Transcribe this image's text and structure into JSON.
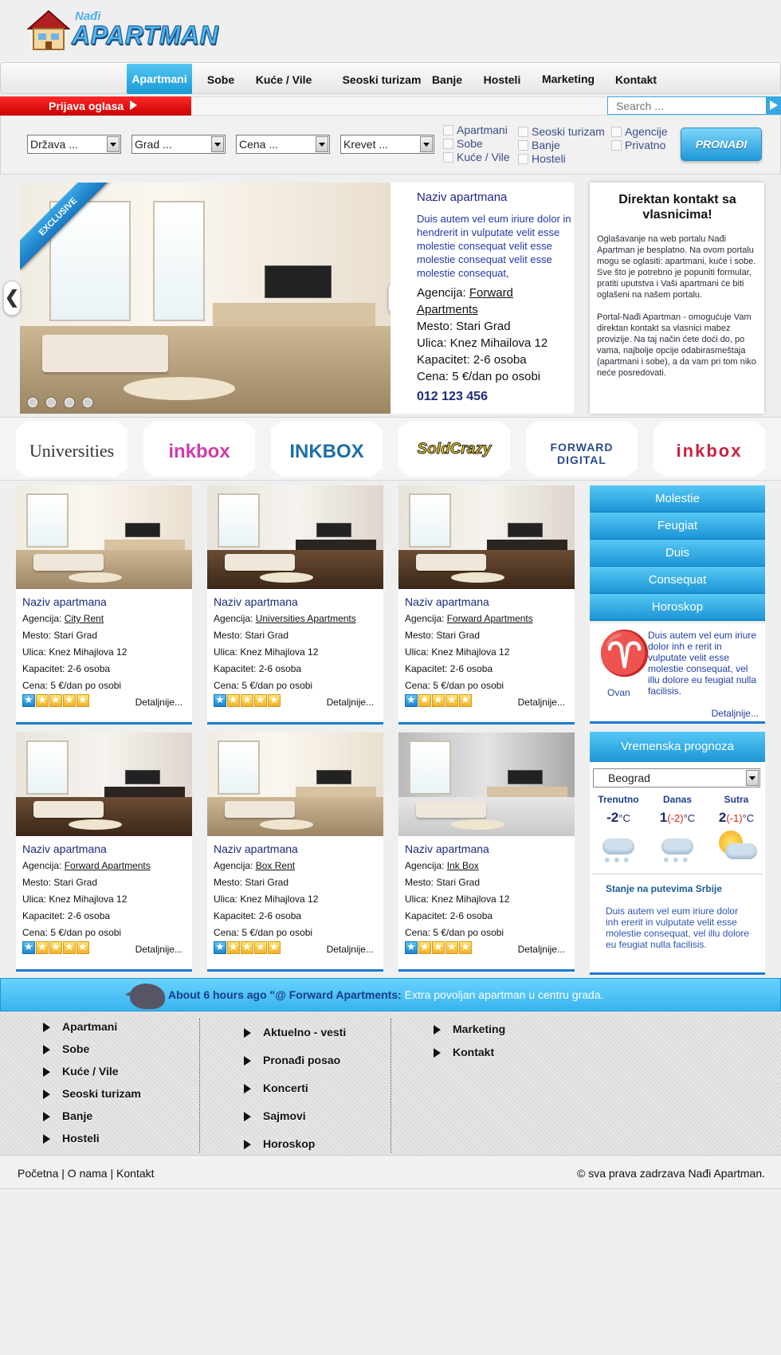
{
  "logo": {
    "top": "Nađi",
    "main": "APARTMAN"
  },
  "nav": [
    "Apartmani",
    "Sobe",
    "Kuće / Vile",
    "Seoski turizam",
    "Banje",
    "Hosteli",
    "Marketing",
    "Kontakt"
  ],
  "nav_active": "Apartmani",
  "prijava": "Prijava oglasa",
  "search": {
    "placeholder": "Search ..."
  },
  "filters": {
    "selects": [
      "Država ...",
      "Grad ...",
      "Cena ...",
      "Krevet ..."
    ],
    "checkboxes": [
      "Apartmani",
      "Sobe",
      "Kuće / Vile",
      "Seoski turizam",
      "Banje",
      "Hosteli",
      "Agencije",
      "Privatno"
    ],
    "button": "PRONAĐI"
  },
  "featured": {
    "badge": "EXCLUSIVE",
    "title": "Naziv apartmana",
    "description": "Duis autem vel eum iriure dolor in hendrerit in vulputate velit esse molestie consequat velit esse molestie consequat velit esse molestie consequat,",
    "agencija_label": "Agencija:",
    "agencija": "Forward Apartments",
    "mesto": "Mesto: Stari Grad",
    "ulica": "Ulica: Knez Mihailova 12",
    "kapacitet": "Kapacitet: 2-6 osoba",
    "cena": "Cena: 5 €/dan po osobi",
    "phone": "012 123 456",
    "prev": "❮",
    "next": "❯"
  },
  "contact": {
    "title": "Direktan kontakt sa vlasnicima!",
    "p1": "Oglašavanje na web portalu Nađi Apartman je besplatno. Na ovom portalu mogu se oglasiti: apartmani, kuće i sobe. Sve što je potrebno je popuniti formular, pratiti uputstva i Vaši apartmani će biti oglašeni na našem portalu.",
    "p2": "Portal-Nađi Apartman - omogućuje Vam direktan kontakt sa vlasnici mabez provizije. Na taj način ćete doći do, po vama, najbolje opcije odabirasmeštaja (apartmani i sobe), a da vam pri tom niko neće posredovati."
  },
  "partners": [
    "Universities",
    "inkbox",
    "INKBOX",
    "SoldCrazy",
    "FORWARD DIGITAL",
    "inkbox"
  ],
  "cards": [
    {
      "title": "Naziv apartmana",
      "agencija_label": "Agencija:",
      "agencija": "City Rent",
      "mesto": "Mesto: Stari Grad",
      "ulica": "Ulica: Knez Mihajlova 12",
      "kapacitet": "Kapacitet: 2-6 osoba",
      "cena": "Cena: 5 €/dan po osobi",
      "more": "Detaljnije..."
    },
    {
      "title": "Naziv apartmana",
      "agencija_label": "Agencija:",
      "agencija": "Universities Apartments",
      "mesto": "Mesto: Stari Grad",
      "ulica": "Ulica: Knez Mihajlova 12",
      "kapacitet": "Kapacitet: 2-6 osoba",
      "cena": "Cena: 5 €/dan po osobi",
      "more": "Detaljnije..."
    },
    {
      "title": "Naziv apartmana",
      "agencija_label": "Agencija:",
      "agencija": "Forward Apartments",
      "mesto": "Mesto: Stari Grad",
      "ulica": "Ulica: Knez Mihajlova 12",
      "kapacitet": "Kapacitet: 2-6 osoba",
      "cena": "Cena: 5 €/dan po osobi",
      "more": "Detaljnije..."
    },
    {
      "title": "Naziv apartmana",
      "agencija_label": "Agencija:",
      "agencija": "Forward Apartments",
      "mesto": "Mesto: Stari Grad",
      "ulica": "Ulica: Knez Mihajlova 12",
      "kapacitet": "Kapacitet: 2-6 osoba",
      "cena": "Cena: 5 €/dan po osobi",
      "more": "Detaljnije..."
    },
    {
      "title": "Naziv apartmana",
      "agencija_label": "Agencija:",
      "agencija": "Box Rent",
      "mesto": "Mesto: Stari Grad",
      "ulica": "Ulica: Knez Mihajlova 12",
      "kapacitet": "Kapacitet: 2-6 osoba",
      "cena": "Cena: 5 €/dan po osobi",
      "more": "Detaljnije..."
    },
    {
      "title": "Naziv apartmana",
      "agencija_label": "Agencija:",
      "agencija": "Ink Box",
      "mesto": "Mesto: Stari Grad",
      "ulica": "Ulica: Knez Mihajlova 12",
      "kapacitet": "Kapacitet: 2-6 osoba",
      "cena": "Cena: 5 €/dan po osobi",
      "more": "Detaljnije..."
    }
  ],
  "rating": {
    "value": 1,
    "max": 5
  },
  "side_menu": [
    "Molestie",
    "Feugiat",
    "Duis",
    "Consequat",
    "Horoskop"
  ],
  "horoscope": {
    "sign": "Ovan",
    "symbol": "♈",
    "text": "Duis autem vel eum iriure dolor inh e rerit in vulputate velit esse molestie consequat, vel illu dolore eu feugiat nulla facilisis.",
    "more": "Detaljnije..."
  },
  "weather": {
    "title": "Vremenska prognoza",
    "city": "Beograd",
    "columns": [
      {
        "label": "Trenutno",
        "temp": "-2",
        "low": "",
        "unit": "°C",
        "icon": "snow-icon"
      },
      {
        "label": "Danas",
        "temp": "1",
        "low": "(-2)",
        "unit": "°C",
        "icon": "snow-icon"
      },
      {
        "label": "Sutra",
        "temp": "2",
        "low": "(-1)",
        "unit": "°C",
        "icon": "sun-cloud-icon"
      }
    ],
    "roads_title": "Stanje na putevima Srbije",
    "roads_text": "Duis autem vel eum iriure dolor inh ererit in vulputate velit esse molestie consequat, vel illu dolore eu feugiat nulla facilisis."
  },
  "tweet": {
    "time": "About 6 hours ago \"@ Forward Apartments:",
    "text": " Extra povoljan apartman u centru grada."
  },
  "footer": {
    "col1": [
      "Apartmani",
      "Sobe",
      "Kuće / Vile",
      "Seoski turizam",
      "Banje",
      "Hosteli"
    ],
    "col2": [
      "Aktuelno - vesti",
      "Pronađi posao",
      "Koncerti",
      "Sajmovi",
      "Horoskop"
    ],
    "col3": [
      "Marketing",
      "Kontakt"
    ]
  },
  "bottom": {
    "links": [
      "Početna",
      "O nama",
      "Kontakt"
    ],
    "copyright": "© sva prava zadrzava Nađi Apartman."
  },
  "colors": {
    "accent": "#1c95d6",
    "red": "#d90000",
    "navy": "#1a2a7a"
  }
}
